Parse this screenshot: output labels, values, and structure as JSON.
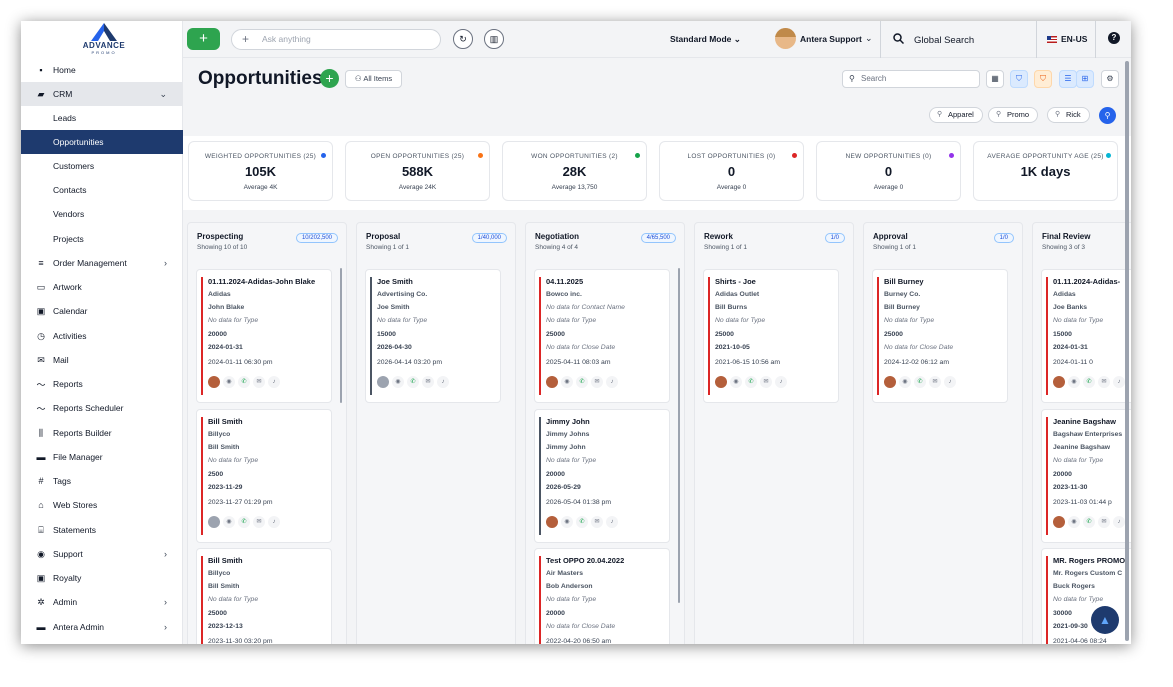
{
  "brand": {
    "name": "ADVANCE",
    "sub": "PROMO",
    "colors": {
      "primary": "#1e3a6e",
      "accent": "#2ea44f",
      "link": "#2563eb"
    }
  },
  "sidebar": {
    "items": [
      {
        "label": "Home",
        "icon": "grid-icon"
      },
      {
        "label": "CRM",
        "icon": "briefcase-icon"
      },
      {
        "label": "Leads"
      },
      {
        "label": "Opportunities"
      },
      {
        "label": "Customers"
      },
      {
        "label": "Contacts"
      },
      {
        "label": "Vendors"
      },
      {
        "label": "Projects"
      },
      {
        "label": "Order Management",
        "icon": "list-icon"
      },
      {
        "label": "Artwork",
        "icon": "artwork-icon"
      },
      {
        "label": "Calendar",
        "icon": "calendar-icon"
      },
      {
        "label": "Activities",
        "icon": "clock-icon"
      },
      {
        "label": "Mail",
        "icon": "mail-icon"
      },
      {
        "label": "Reports",
        "icon": "trend-icon"
      },
      {
        "label": "Reports Scheduler",
        "icon": "trend-icon"
      },
      {
        "label": "Reports Builder",
        "icon": "bar-chart-icon"
      },
      {
        "label": "File Manager",
        "icon": "folder-icon"
      },
      {
        "label": "Tags",
        "icon": "hash-icon"
      },
      {
        "label": "Web Stores",
        "icon": "store-icon"
      },
      {
        "label": "Statements",
        "icon": "bank-icon"
      },
      {
        "label": "Support",
        "icon": "help-circle-icon"
      },
      {
        "label": "Royalty",
        "icon": "calendar-icon"
      },
      {
        "label": "Admin",
        "icon": "gear-icon"
      },
      {
        "label": "Antera Admin",
        "icon": "lock-icon"
      }
    ]
  },
  "topbar": {
    "ask_placeholder": "Ask anything",
    "mode": "Standard Mode",
    "user": "Antera Support",
    "global_search": "Global Search",
    "language": "EN-US"
  },
  "header": {
    "title": "Opportunities",
    "all_items": "All Items",
    "search_placeholder": "Search"
  },
  "chips": [
    "Apparel",
    "Promo",
    "Rick"
  ],
  "stats": [
    {
      "label": "WEIGHTED OPPORTUNITIES (25)",
      "value": "105K",
      "sub": "Average 4K",
      "dot": "#2563eb"
    },
    {
      "label": "OPEN OPPORTUNITIES (25)",
      "value": "588K",
      "sub": "Average 24K",
      "dot": "#f97316"
    },
    {
      "label": "WON OPPORTUNITIES (2)",
      "value": "28K",
      "sub": "Average 13,750",
      "dot": "#16a34a"
    },
    {
      "label": "LOST OPPORTUNITIES (0)",
      "value": "0",
      "sub": "Average 0",
      "dot": "#dc2626"
    },
    {
      "label": "NEW OPPORTUNITIES (0)",
      "value": "0",
      "sub": "Average 0",
      "dot": "#9333ea"
    },
    {
      "label": "AVERAGE OPPORTUNITY AGE (25)",
      "value": "1K days",
      "sub": "",
      "dot": "#06b6d4"
    }
  ],
  "columns": [
    {
      "title": "Prospecting",
      "showing": "Showing 10 of 10",
      "badge": "10/202,500",
      "cards": [
        {
          "lines": [
            "01.11.2024-Adidas-John Blake",
            "Adidas",
            "John Blake",
            "No data for Type",
            "20000",
            "2024-01-31",
            "2024-01-11 06:30 pm"
          ]
        },
        {
          "lines": [
            "Bill Smith",
            "Billyco",
            "Bill Smith",
            "No data for Type",
            "2500",
            "2023-11-29",
            "2023-11-27 01:29 pm"
          ]
        },
        {
          "lines": [
            "Bill Smith",
            "Billyco",
            "Bill Smith",
            "No data for Type",
            "25000",
            "2023-12-13",
            "2023-11-30 03:20 pm"
          ]
        }
      ]
    },
    {
      "title": "Proposal",
      "showing": "Showing 1 of 1",
      "badge": "1/40,000",
      "cards": [
        {
          "lines": [
            "Joe Smith",
            "Advertising Co.",
            "Joe Smith",
            "No data for Type",
            "15000",
            "2026-04-30",
            "2026-04-14 03:20 pm"
          ]
        }
      ]
    },
    {
      "title": "Negotiation",
      "showing": "Showing 4 of 4",
      "badge": "4/65,500",
      "cards": [
        {
          "lines": [
            "04.11.2025",
            "Bowco inc.",
            "No data for Contact Name",
            "No data for Type",
            "25000",
            "No data for Close Date",
            "2025-04-11 08:03 am"
          ]
        },
        {
          "lines": [
            "Jimmy John",
            "Jimmy Johns",
            "Jimmy John",
            "No data for Type",
            "20000",
            "2026-05-29",
            "2026-05-04 01:38 pm"
          ]
        },
        {
          "lines": [
            "Test OPPO 20.04.2022",
            "Air Masters",
            "Bob Anderson",
            "No data for Type",
            "20000",
            "No data for Close Date",
            "2022-04-20 06:50 am"
          ]
        }
      ]
    },
    {
      "title": "Rework",
      "showing": "Showing 1 of 1",
      "badge": "1/0",
      "cards": [
        {
          "lines": [
            "Shirts - Joe",
            "Adidas Outlet",
            "Bill Burns",
            "No data for Type",
            "25000",
            "2021-10-05",
            "2021-06-15 10:56 am"
          ]
        }
      ]
    },
    {
      "title": "Approval",
      "showing": "Showing 1 of 1",
      "badge": "1/0",
      "cards": [
        {
          "lines": [
            "Bill Burney",
            "Burney Co.",
            "Bill Burney",
            "No data for Type",
            "25000",
            "No data for Close Date",
            "2024-12-02 06:12 am"
          ]
        }
      ]
    },
    {
      "title": "Final Review",
      "showing": "Showing 3 of 3",
      "badge": "",
      "cards": [
        {
          "lines": [
            "01.11.2024-Adidas-",
            "Adidas",
            "Joe Banks",
            "No data for Type",
            "15000",
            "2024-01-31",
            "2024-01-11 0"
          ]
        },
        {
          "lines": [
            "Jeanine Bagshaw",
            "Bagshaw Enterprises",
            "Jeanine Bagshaw",
            "No data for Type",
            "20000",
            "2023-11-30",
            "2023-11-03 01:44 p"
          ]
        },
        {
          "lines": [
            "MR. Rogers PROMO",
            "Mr. Rogers Custom C",
            "Buck Rogers",
            "No data for Type",
            "30000",
            "2021-09-30",
            "2021-04-06 08:24"
          ]
        }
      ]
    }
  ]
}
